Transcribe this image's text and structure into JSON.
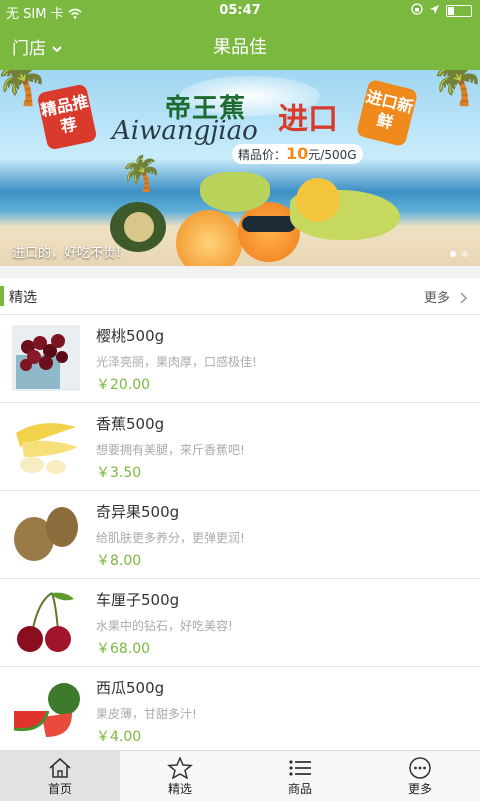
{
  "status_bar": {
    "carrier": "无 SIM 卡",
    "time": "05:47"
  },
  "header": {
    "store_label": "门店",
    "title": "果品佳"
  },
  "banner": {
    "tag_left": "精品推荐",
    "title_cn": "帝王蕉",
    "title_cn2": "进口",
    "script": "Aiwangjiao",
    "price_label": "精品价：",
    "price_value": "10",
    "price_unit": "元/500G",
    "tag_right": "进口新鲜",
    "caption": "进口的，好吃不贵!"
  },
  "section": {
    "title": "精选",
    "more": "更多"
  },
  "products": [
    {
      "name": "樱桃500g",
      "desc": "光泽亮丽，果肉厚，口感极佳!",
      "price": "￥20.00",
      "icon": "cherries-photo"
    },
    {
      "name": "香蕉500g",
      "desc": "想要拥有美腿，来斤香蕉吧!",
      "price": "￥3.50",
      "icon": "banana-photo"
    },
    {
      "name": "奇异果500g",
      "desc": "给肌肤更多养分，更弹更润!",
      "price": "￥8.00",
      "icon": "kiwi-photo"
    },
    {
      "name": "车厘子500g",
      "desc": "水果中的钻石，好吃美容!",
      "price": "￥68.00",
      "icon": "cherry-photo"
    },
    {
      "name": "西瓜500g",
      "desc": "果皮薄，甘甜多汁!",
      "price": "￥4.00",
      "icon": "watermelon-photo"
    }
  ],
  "tabs": [
    {
      "label": "首页",
      "icon": "home-icon"
    },
    {
      "label": "精选",
      "icon": "star-icon"
    },
    {
      "label": "商品",
      "icon": "list-icon"
    },
    {
      "label": "更多",
      "icon": "more-icon"
    }
  ],
  "colors": {
    "brand": "#7ab840",
    "price": "#7ab840"
  }
}
